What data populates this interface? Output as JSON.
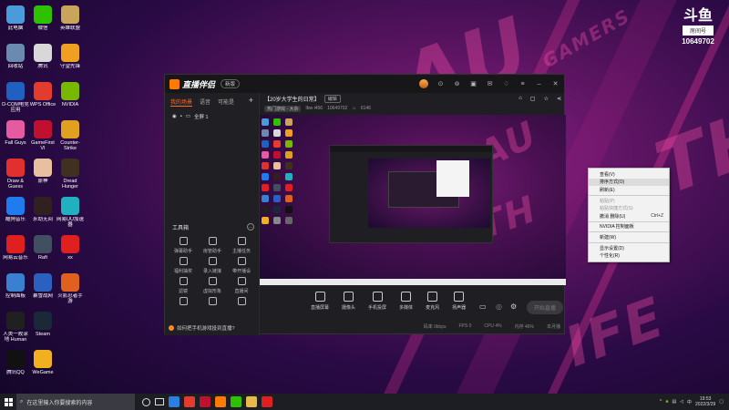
{
  "desktop": {
    "icons": [
      {
        "label": "此电脑",
        "color": "#4a9bdc"
      },
      {
        "label": "微信",
        "color": "#2dc100"
      },
      {
        "label": "英雄联盟",
        "color": "#c8a55a"
      },
      {
        "label": "回收站",
        "color": "#6a8ab0"
      },
      {
        "label": "腾讯",
        "color": "#d8d8d8"
      },
      {
        "label": "守望先锋",
        "color": "#f0a020"
      },
      {
        "label": "D-COM电竞应用",
        "color": "#2060c0"
      },
      {
        "label": "WPS Office",
        "color": "#e33b2e"
      },
      {
        "label": "NVIDIA",
        "color": "#76b900"
      },
      {
        "label": "Fall Guys",
        "color": "#e55aa0"
      },
      {
        "label": "GameFirst VI",
        "color": "#c01030"
      },
      {
        "label": "Counter-Strike Global Off...",
        "color": "#e0a020"
      },
      {
        "label": "Draw & Guess",
        "color": "#e03030"
      },
      {
        "label": "原神",
        "color": "#e8c0a0"
      },
      {
        "label": "Dread Hunger",
        "color": "#403020"
      },
      {
        "label": "酷狗音乐",
        "color": "#1f7cf0"
      },
      {
        "label": "永劫无间",
        "color": "#302020"
      },
      {
        "label": "网易UU加速器",
        "color": "#20b0c0"
      },
      {
        "label": "网易云音乐",
        "color": "#e02020"
      },
      {
        "label": "Raft",
        "color": "#405060"
      },
      {
        "label": "xx",
        "color": "#e02020"
      },
      {
        "label": "控制面板",
        "color": "#3a80d0"
      },
      {
        "label": "暴雪战网",
        "color": "#2a60c0"
      },
      {
        "label": "火影忍者手游",
        "color": "#e06020"
      },
      {
        "label": "人类一败涂地 Human Fa...",
        "color": "#202020"
      },
      {
        "label": "Steam",
        "color": "#1b2838"
      },
      {
        "label": "",
        "color": "transparent"
      },
      {
        "label": "腾讯QQ",
        "color": "#111111"
      },
      {
        "label": "WeGame",
        "color": "#f0b020"
      },
      {
        "label": "",
        "color": "transparent"
      }
    ]
  },
  "brand": {
    "logo": "斗鱼",
    "room_label": "房间号",
    "room_number": "10649702"
  },
  "app": {
    "name": "直播伴侣",
    "version_badge": "新版",
    "left_tabs": [
      "我的场景",
      "语音",
      "可能是"
    ],
    "add_label": "+",
    "scene_label": "全屏 1",
    "tools_header": "工具箱",
    "tools": [
      {
        "label": "弹幕助手"
      },
      {
        "label": "房管助手"
      },
      {
        "label": "主播任务"
      },
      {
        "label": "福利抽奖"
      },
      {
        "label": "录入链接"
      },
      {
        "label": "带开播设"
      },
      {
        "label": "滤镜"
      },
      {
        "label": "虚拟形象"
      },
      {
        "label": "直播间"
      },
      {
        "label": ""
      },
      {
        "label": ""
      },
      {
        "label": ""
      }
    ],
    "help_text": "如何把手机游戏投到直播?",
    "room_title": "【20岁大学生的日常】",
    "edit_label": "编辑",
    "category_tag": "热门游戏 - 大杂",
    "meta_user": "lbw·i456",
    "meta_room": "10649702",
    "meta_hot": "6146",
    "controls": [
      {
        "label": "直播屏幕"
      },
      {
        "label": "摄像头"
      },
      {
        "label": "手机投屏"
      },
      {
        "label": "多媒体"
      },
      {
        "label": "麦克风"
      },
      {
        "label": "扬声器"
      }
    ],
    "start_live_label": "开始直播",
    "status": [
      "码率 0kbps",
      "FPS 0",
      "CPU 4%",
      "内存 46%",
      "本月播"
    ]
  },
  "context_menu": {
    "items": [
      {
        "label": "查看(V)",
        "shortcut": "",
        "disabled": false
      },
      {
        "label": "排序方式(O)",
        "shortcut": "",
        "disabled": false
      },
      {
        "label": "刷新(E)",
        "shortcut": "",
        "disabled": false
      },
      {
        "label": "粘贴(P)",
        "shortcut": "",
        "disabled": true
      },
      {
        "label": "粘贴快捷方式(S)",
        "shortcut": "",
        "disabled": true
      },
      {
        "label": "撤消 删除(U)",
        "shortcut": "Ctrl+Z",
        "disabled": false
      },
      {
        "label": "NVIDIA 控制面板",
        "shortcut": "",
        "disabled": false
      },
      {
        "label": "新建(W)",
        "shortcut": "",
        "disabled": false
      },
      {
        "label": "显示设置(D)",
        "shortcut": "",
        "disabled": false
      },
      {
        "label": "个性化(R)",
        "shortcut": "",
        "disabled": false
      }
    ]
  },
  "taskbar": {
    "search_placeholder": "在这里输入你要搜索的内容",
    "time": "19:53",
    "date": "2022/3/29",
    "ime": "中"
  }
}
